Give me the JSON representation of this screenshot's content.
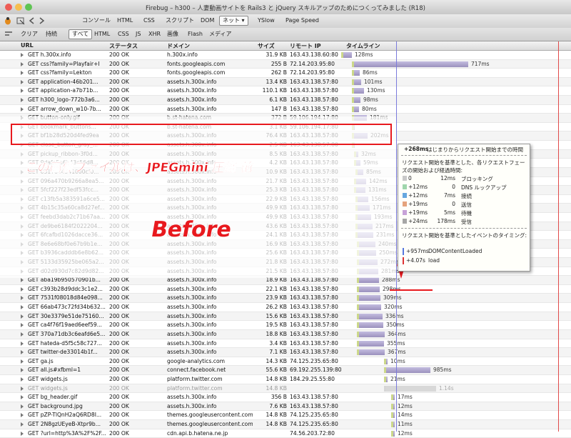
{
  "window": {
    "title": "Firebug – h300 – 人妻動画サイトを Rails3 と jQuery スキルアップのためにつくってみました (R18)"
  },
  "toolbar": {
    "tabs": [
      {
        "label": "コンソール",
        "selected": false
      },
      {
        "label": "HTML",
        "selected": false
      },
      {
        "label": "CSS",
        "selected": false
      },
      {
        "label": "スクリプト",
        "selected": false
      },
      {
        "label": "DOM",
        "selected": false
      },
      {
        "label": "ネット ▾",
        "selected": true
      },
      {
        "label": "YSlow",
        "selected": false
      },
      {
        "label": "Page Speed",
        "selected": false
      }
    ]
  },
  "filterbar": {
    "clear": "クリア",
    "persist": "持続",
    "filters": [
      {
        "label": "すべて",
        "selected": true
      },
      {
        "label": "HTML",
        "selected": false
      },
      {
        "label": "CSS",
        "selected": false
      },
      {
        "label": "JS",
        "selected": false
      },
      {
        "label": "XHR",
        "selected": false
      },
      {
        "label": "画像",
        "selected": false
      },
      {
        "label": "Flash",
        "selected": false
      },
      {
        "label": "メディア",
        "selected": false
      }
    ]
  },
  "columns": {
    "url": "URL",
    "status": "ステータス",
    "domain": "ドメイン",
    "size": "サイズ",
    "remote_ip": "リモート IP",
    "timeline": "タイムライン"
  },
  "rows": [
    {
      "url": "GET h.300x.info",
      "status": "200 OK",
      "domain": "h.300x.info",
      "size": "31.9 KB",
      "ip": "163.43.138.60:80",
      "ms": "128ms",
      "wait": 0,
      "recv": 12,
      "gray": false
    },
    {
      "url": "GET css?family=Playfair+I",
      "status": "200 OK",
      "domain": "fonts.googleapis.com",
      "size": "255 B",
      "ip": "72.14.203.95:80",
      "ms": "717ms",
      "wait": 15,
      "recv": 160,
      "gray": false
    },
    {
      "url": "GET css?family=Lekton",
      "status": "200 OK",
      "domain": "fonts.googleapis.com",
      "size": "262 B",
      "ip": "72.14.203.95:80",
      "ms": "86ms",
      "wait": 15,
      "recv": 8,
      "gray": false
    },
    {
      "url": "GET application-46b201...",
      "status": "200 OK",
      "domain": "assets.h.300x.info",
      "size": "13.4 KB",
      "ip": "163.43.138.57:80",
      "ms": "101ms",
      "wait": 15,
      "recv": 10,
      "gray": false
    },
    {
      "url": "GET application-a7b71b...",
      "status": "200 OK",
      "domain": "assets.h.300x.info",
      "size": "110.1 KB",
      "ip": "163.43.138.57:80",
      "ms": "130ms",
      "wait": 15,
      "recv": 14,
      "gray": false
    },
    {
      "url": "GET h300_logo-772b3a6...",
      "status": "200 OK",
      "domain": "assets.h.300x.info",
      "size": "6.1 KB",
      "ip": "163.43.138.57:80",
      "ms": "98ms",
      "wait": 15,
      "recv": 9,
      "gray": false
    },
    {
      "url": "GET arrow_down_w10-7b...",
      "status": "200 OK",
      "domain": "assets.h.300x.info",
      "size": "147 B",
      "ip": "163.43.138.57:80",
      "ms": "80ms",
      "wait": 15,
      "recv": 7,
      "gray": false
    },
    {
      "url": "GET button-only.gif",
      "status": "200 OK",
      "domain": "b.st-hatena.com",
      "size": "372 B",
      "ip": "59.106.194.17:80",
      "ms": "181ms",
      "wait": 15,
      "recv": 18,
      "gray": false
    },
    {
      "url": "GET bookmark_buttons...",
      "status": "200 OK",
      "domain": "b.st-hatena.com",
      "size": "3.1 KB",
      "ip": "59.106.194.17:80",
      "ms": "",
      "wait": 15,
      "recv": 0,
      "gray": false
    },
    {
      "url": "GET bf1b28d520d4fed9ea",
      "status": "200 OK",
      "domain": "assets.h.300x.info",
      "size": "76.4 KB",
      "ip": "163.43.138.57:80",
      "ms": "202ms",
      "wait": 15,
      "recv": 19,
      "gray": false
    },
    {
      "url": "GET close_button_gray_...",
      "status": "200 OK",
      "domain": "assets.h.300x.info",
      "size": "2.5 KB",
      "ip": "163.43.138.57:80",
      "ms": "",
      "wait": 15,
      "recv": 0,
      "gray": false
    },
    {
      "url": "GET pickup_ribbon-3f0d...",
      "status": "200 OK",
      "domain": "assets.h.300x.info",
      "size": "8.5 KB",
      "ip": "163.43.138.57:80",
      "ms": "32ms",
      "wait": 18,
      "recv": 3,
      "gray": false
    },
    {
      "url": "GET 9dafa5a6b43c56d8...",
      "status": "200 OK",
      "domain": "assets.h.300x.info",
      "size": "4.2 KB",
      "ip": "163.43.138.57:80",
      "ms": "59ms",
      "wait": 18,
      "recv": 6,
      "gray": false
    },
    {
      "url": "GET 0517644341000cf0...",
      "status": "200 OK",
      "domain": "assets.h.300x.info",
      "size": "10.9 KB",
      "ip": "163.43.138.57:80",
      "ms": "85ms",
      "wait": 20,
      "recv": 8,
      "gray": false
    },
    {
      "url": "GET 096a470b9266a8ea5...",
      "status": "200 OK",
      "domain": "assets.h.300x.info",
      "size": "21.7 KB",
      "ip": "163.43.138.57:80",
      "ms": "142ms",
      "wait": 18,
      "recv": 14,
      "gray": false
    },
    {
      "url": "GET 5fcf227f23edf53fcc...",
      "status": "200 OK",
      "domain": "assets.h.300x.info",
      "size": "25.3 KB",
      "ip": "163.43.138.57:80",
      "ms": "131ms",
      "wait": 18,
      "recv": 13,
      "gray": false
    },
    {
      "url": "GET c13fb5a383591a6ce5...",
      "status": "200 OK",
      "domain": "assets.h.300x.info",
      "size": "22.9 KB",
      "ip": "163.43.138.57:80",
      "ms": "156ms",
      "wait": 20,
      "recv": 15,
      "gray": false
    },
    {
      "url": "GET 4b15c35a60ca8d27ef...",
      "status": "200 OK",
      "domain": "assets.h.300x.info",
      "size": "49.9 KB",
      "ip": "163.43.138.57:80",
      "ms": "171ms",
      "wait": 20,
      "recv": 17,
      "gray": false
    },
    {
      "url": "GET feebd3dab2c71b67aa...",
      "status": "200 OK",
      "domain": "assets.h.300x.info",
      "size": "49.9 KB",
      "ip": "163.43.138.57:80",
      "ms": "193ms",
      "wait": 20,
      "recv": 19,
      "gray": false
    },
    {
      "url": "GET de9be6184f2022204...",
      "status": "200 OK",
      "domain": "assets.h.300x.info",
      "size": "43.6 KB",
      "ip": "163.43.138.57:80",
      "ms": "217ms",
      "wait": 20,
      "recv": 21,
      "gray": false
    },
    {
      "url": "GET 6fcafbd1026dacce36...",
      "status": "200 OK",
      "domain": "assets.h.300x.info",
      "size": "24.1 KB",
      "ip": "163.43.138.57:80",
      "ms": "231ms",
      "wait": 20,
      "recv": 22,
      "gray": false
    },
    {
      "url": "GET 8e6e68bf0e67b9b1e...",
      "status": "200 OK",
      "domain": "assets.h.300x.info",
      "size": "16.9 KB",
      "ip": "163.43.138.57:80",
      "ms": "240ms",
      "wait": 22,
      "recv": 23,
      "gray": false
    },
    {
      "url": "GET b3936cadddb6e8b62...",
      "status": "200 OK",
      "domain": "assets.h.300x.info",
      "size": "25.6 KB",
      "ip": "163.43.138.57:80",
      "ms": "250ms",
      "wait": 22,
      "recv": 24,
      "gray": false
    },
    {
      "url": "GET 5133d35925be065a2...",
      "status": "200 OK",
      "domain": "assets.h.300x.info",
      "size": "21.8 KB",
      "ip": "163.43.138.57:80",
      "ms": "272ms",
      "wait": 22,
      "recv": 26,
      "gray": false
    },
    {
      "url": "GET d02d930d7c82d9d82...",
      "status": "200 OK",
      "domain": "assets.h.300x.info",
      "size": "21.5 KB",
      "ip": "163.43.138.57:80",
      "ms": "281ms",
      "wait": 22,
      "recv": 27,
      "gray": false
    },
    {
      "url": "GET aba19b950570901b...",
      "status": "200 OK",
      "domain": "assets.h.300x.info",
      "size": "18.9 KB",
      "ip": "163.43.138.57:80",
      "ms": "288ms",
      "wait": 22,
      "recv": 28,
      "gray": false
    },
    {
      "url": "GET c393b28d9ddc3c1e2...",
      "status": "200 OK",
      "domain": "assets.h.300x.info",
      "size": "22.1 KB",
      "ip": "163.43.138.57:80",
      "ms": "298ms",
      "wait": 22,
      "recv": 29,
      "gray": false
    },
    {
      "url": "GET 7531f08018d84e098...",
      "status": "200 OK",
      "domain": "assets.h.300x.info",
      "size": "23.9 KB",
      "ip": "163.43.138.57:80",
      "ms": "309ms",
      "wait": 22,
      "recv": 30,
      "gray": false
    },
    {
      "url": "GET 66ab473c72fd34b632...",
      "status": "200 OK",
      "domain": "assets.h.300x.info",
      "size": "26.2 KB",
      "ip": "163.43.138.57:80",
      "ms": "320ms",
      "wait": 22,
      "recv": 31,
      "gray": false
    },
    {
      "url": "GET 30e3379e51de75160...",
      "status": "200 OK",
      "domain": "assets.h.300x.info",
      "size": "15.6 KB",
      "ip": "163.43.138.57:80",
      "ms": "336ms",
      "wait": 22,
      "recv": 33,
      "gray": false
    },
    {
      "url": "GET ca4f76f19aed6eef59...",
      "status": "200 OK",
      "domain": "assets.h.300x.info",
      "size": "19.5 KB",
      "ip": "163.43.138.57:80",
      "ms": "350ms",
      "wait": 22,
      "recv": 34,
      "gray": false
    },
    {
      "url": "GET 370a71db3c6eafd6e5...",
      "status": "200 OK",
      "domain": "assets.h.300x.info",
      "size": "18.8 KB",
      "ip": "163.43.138.57:80",
      "ms": "364ms",
      "wait": 22,
      "recv": 36,
      "gray": false
    },
    {
      "url": "GET hateda-d5f5c58c727...",
      "status": "200 OK",
      "domain": "assets.h.300x.info",
      "size": "3.4 KB",
      "ip": "163.43.138.57:80",
      "ms": "355ms",
      "wait": 22,
      "recv": 35,
      "gray": false
    },
    {
      "url": "GET twitter-de33014b1f...",
      "status": "200 OK",
      "domain": "assets.h.300x.info",
      "size": "7.1 KB",
      "ip": "163.43.138.57:80",
      "ms": "367ms",
      "wait": 22,
      "recv": 36,
      "gray": false
    },
    {
      "url": "GET ga.js",
      "status": "200 OK",
      "domain": "google-analytics.com",
      "size": "14.3 KB",
      "ip": "74.125.235.65:80",
      "ms": "10ms",
      "wait": 60,
      "recv": 2,
      "gray": false
    },
    {
      "url": "GET all.js#xfbml=1",
      "status": "200 OK",
      "domain": "connect.facebook.net",
      "size": "55.6 KB",
      "ip": "69.192.255.139:80",
      "ms": "985ms",
      "wait": 60,
      "recv": 62,
      "gray": false
    },
    {
      "url": "GET widgets.js",
      "status": "200 OK",
      "domain": "platform.twitter.com",
      "size": "14.8 KB",
      "ip": "184.29.25.55:80",
      "ms": "21ms",
      "wait": 60,
      "recv": 2,
      "gray": false
    },
    {
      "url": "GET widgets.js",
      "status": "200 OK",
      "domain": "platform.twitter.com",
      "size": "14.8 KB",
      "ip": "",
      "ms": "1.14s",
      "wait": 60,
      "recv": 70,
      "gray": true
    },
    {
      "url": "GET bg_header.gif",
      "status": "200 OK",
      "domain": "assets.h.300x.info",
      "size": "356 B",
      "ip": "163.43.138.57:80",
      "ms": "17ms",
      "wait": 70,
      "recv": 2,
      "gray": false
    },
    {
      "url": "GET background.jpg",
      "status": "200 OK",
      "domain": "assets.h.300x.info",
      "size": "7.6 KB",
      "ip": "163.43.138.57:80",
      "ms": "12ms",
      "wait": 70,
      "recv": 2,
      "gray": false
    },
    {
      "url": "GET pZP-TlQnH2aQ6RD8I...",
      "status": "200 OK",
      "domain": "themes.googleusercontent.com",
      "size": "14.8 KB",
      "ip": "74.125.235.65:80",
      "ms": "14ms",
      "wait": 70,
      "recv": 2,
      "gray": false
    },
    {
      "url": "GET 2N8gzUEyeB-Xtpr9b...",
      "status": "200 OK",
      "domain": "themes.googleusercontent.com",
      "size": "14.8 KB",
      "ip": "74.125.235.65:80",
      "ms": "11ms",
      "wait": 70,
      "recv": 2,
      "gray": false
    },
    {
      "url": "GET ?url=http%3A%2F%2F...",
      "status": "200 OK",
      "domain": "cdn.api.b.hatena.ne.jp",
      "size": "",
      "ip": "74.56.203.72:80",
      "ms": "12ms",
      "wait": 70,
      "recv": 2,
      "gray": false
    }
  ],
  "annotations": {
    "note": "この画像ファイルは、JPEGmini 圧縮 前",
    "before": "Before"
  },
  "tooltip": {
    "header_time": "+268ms",
    "header_text": "はじまりからリクエスト開始までの時間",
    "phase_title1": "リクエスト開始を基準とした、各リクエストフェー",
    "phase_title2": "ズの開始および経過時間:",
    "phases": [
      {
        "start": "0",
        "dur": "12ms",
        "name": "ブロッキング",
        "color": "#c9c9c9"
      },
      {
        "start": "+12ms",
        "dur": "0",
        "name": "DNS ルックアップ",
        "color": "#9fd6ab"
      },
      {
        "start": "+12ms",
        "dur": "7ms",
        "name": "接続",
        "color": "#66a7df"
      },
      {
        "start": "+19ms",
        "dur": "0",
        "name": "送信",
        "color": "#e5a37d"
      },
      {
        "start": "+19ms",
        "dur": "5ms",
        "name": "待機",
        "color": "#c7a2d8"
      },
      {
        "start": "+24ms",
        "dur": "178ms",
        "name": "受信",
        "color": "#a6a6a6"
      }
    ],
    "event_title": "リクエスト開始を基準としたイベントのタイミング:",
    "events": [
      {
        "time": "+957ms",
        "name": "DOMContentLoaded",
        "color": "#5577dd"
      },
      {
        "time": "+4.07s",
        "name": "load",
        "color": "#dd3333"
      }
    ]
  },
  "colors": {
    "red_annotation": "#e8191e",
    "recv_bar": "#a9a0c6",
    "wait_bar": "#ccd88a"
  }
}
